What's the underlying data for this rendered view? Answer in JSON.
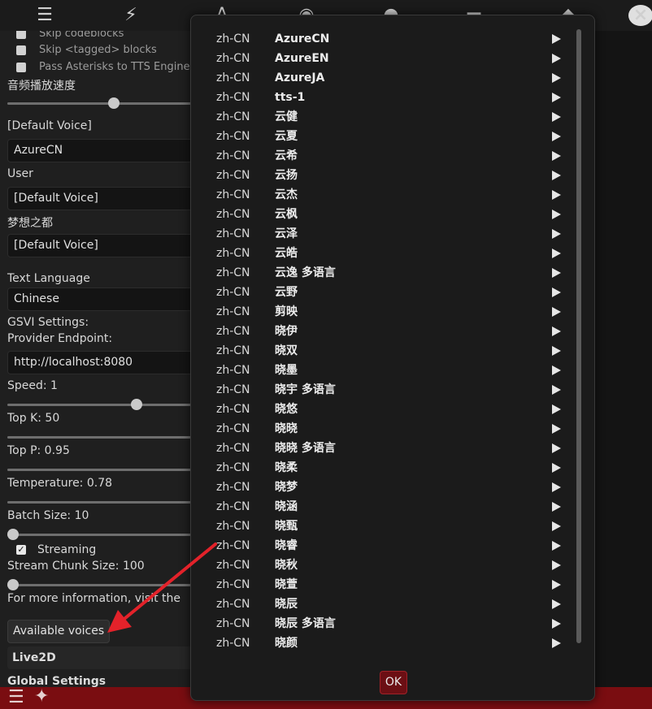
{
  "colors": {
    "accent": "#7a0d11",
    "arrow": "#e3222a",
    "play": "#e6e6e6"
  },
  "toolbar": {
    "icons": [
      "sliders-icon",
      "plug-alert-icon",
      "font-icon",
      "globe-icon",
      "user-icon",
      "id-card-icon",
      "cube-icon"
    ]
  },
  "settings": {
    "skip_codeblocks": "Skip codeblocks",
    "skip_tagged": "Skip <tagged> blocks",
    "pass_asterisks": "Pass Asterisks to TTS Engine",
    "playback_speed_label": "音频播放速度",
    "default_voice_label": "[Default Voice]",
    "default_voice_value": "AzureCN",
    "user_label": "User",
    "user_voice": "[Default Voice]",
    "char_label": "梦想之都",
    "char_voice": "[Default Voice]",
    "text_language_label": "Text Language",
    "text_language_value": "Chinese",
    "gsvi_label": "GSVI Settings:",
    "endpoint_label": "Provider Endpoint:",
    "endpoint_value": "http://localhost:8080",
    "speed_label": "Speed: 1",
    "topk_label": "Top K: 50",
    "topp_label": "Top P: 0.95",
    "temperature_label": "Temperature: 0.78",
    "batch_label": "Batch Size: 10",
    "streaming_label": "Streaming",
    "chunk_label": "Stream Chunk Size: 100",
    "more_info": "For more information, visit the",
    "available_voices": "Available voices",
    "live2d": "Live2D",
    "global_settings": "Global Settings"
  },
  "voices": [
    {
      "lang": "zh-CN",
      "name": "AzureCN"
    },
    {
      "lang": "zh-CN",
      "name": "AzureEN"
    },
    {
      "lang": "zh-CN",
      "name": "AzureJA"
    },
    {
      "lang": "zh-CN",
      "name": "tts-1"
    },
    {
      "lang": "zh-CN",
      "name": "云健"
    },
    {
      "lang": "zh-CN",
      "name": "云夏"
    },
    {
      "lang": "zh-CN",
      "name": "云希"
    },
    {
      "lang": "zh-CN",
      "name": "云扬"
    },
    {
      "lang": "zh-CN",
      "name": "云杰"
    },
    {
      "lang": "zh-CN",
      "name": "云枫"
    },
    {
      "lang": "zh-CN",
      "name": "云泽"
    },
    {
      "lang": "zh-CN",
      "name": "云皓"
    },
    {
      "lang": "zh-CN",
      "name": "云逸 多语言"
    },
    {
      "lang": "zh-CN",
      "name": "云野"
    },
    {
      "lang": "zh-CN",
      "name": "剪映"
    },
    {
      "lang": "zh-CN",
      "name": "晓伊"
    },
    {
      "lang": "zh-CN",
      "name": "晓双"
    },
    {
      "lang": "zh-CN",
      "name": "晓墨"
    },
    {
      "lang": "zh-CN",
      "name": "晓宇 多语言"
    },
    {
      "lang": "zh-CN",
      "name": "晓悠"
    },
    {
      "lang": "zh-CN",
      "name": "晓晓"
    },
    {
      "lang": "zh-CN",
      "name": "晓晓 多语言"
    },
    {
      "lang": "zh-CN",
      "name": "晓柔"
    },
    {
      "lang": "zh-CN",
      "name": "晓梦"
    },
    {
      "lang": "zh-CN",
      "name": "晓涵"
    },
    {
      "lang": "zh-CN",
      "name": "晓甄"
    },
    {
      "lang": "zh-CN",
      "name": "晓睿"
    },
    {
      "lang": "zh-CN",
      "name": "晓秋"
    },
    {
      "lang": "zh-CN",
      "name": "晓萱"
    },
    {
      "lang": "zh-CN",
      "name": "晓辰"
    },
    {
      "lang": "zh-CN",
      "name": "晓辰 多语言"
    },
    {
      "lang": "zh-CN",
      "name": "晓颜"
    }
  ],
  "dialog": {
    "ok_label": "OK"
  }
}
